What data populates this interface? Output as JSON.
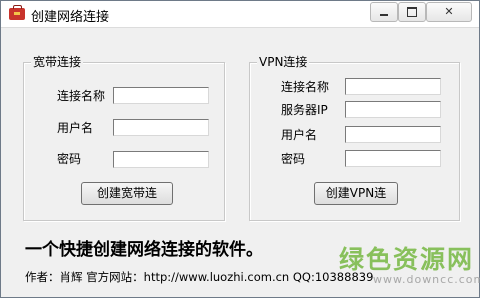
{
  "window": {
    "title": "创建网络连接",
    "controls": {
      "minimize": "minimize",
      "maximize": "maximize",
      "close": "✕"
    }
  },
  "broadband": {
    "legend": "宽带连接",
    "fields": [
      {
        "label": "连接名称",
        "value": ""
      },
      {
        "label": "用户名",
        "value": ""
      },
      {
        "label": "密码",
        "value": ""
      }
    ],
    "button": "创建宽带连"
  },
  "vpn": {
    "legend": "VPN连接",
    "fields": [
      {
        "label": "连接名称",
        "value": ""
      },
      {
        "label": "服务器IP",
        "value": ""
      },
      {
        "label": "用户名",
        "value": ""
      },
      {
        "label": "密码",
        "value": ""
      }
    ],
    "button": "创建VPN连"
  },
  "slogan": "一个快捷创建网络连接的软件。",
  "footer": "作者：肖辉 官方网站：http://www.luozhi.com.cn QQ:10388839",
  "watermark": {
    "main": "绿色资源网",
    "url": "www.downcc.com"
  },
  "colors": {
    "watermark": "#76b843",
    "icon": "#c8342c"
  }
}
